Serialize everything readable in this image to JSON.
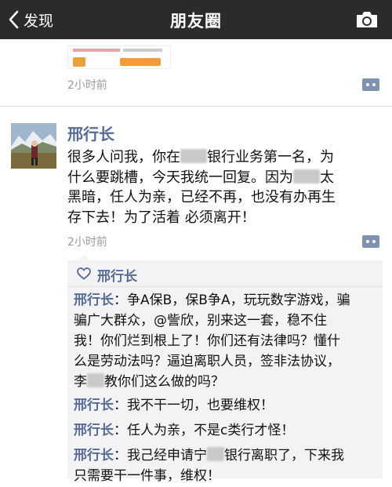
{
  "header": {
    "back_label": "发现",
    "title": "朋友圈"
  },
  "previous_post": {
    "time": "2小时前"
  },
  "post": {
    "author": "邢行长",
    "lines": [
      [
        "很多人问我，你在",
        "银行业务第一名，为"
      ],
      [
        "什么要跳槽，今天我统一回复。因为",
        "太"
      ],
      [
        "黑暗，任人为亲，已经不再，也没有办再生"
      ],
      [
        "存下去！为了活着 必须离开！"
      ]
    ],
    "time": "2小时前"
  },
  "likes": {
    "names": "邢行长"
  },
  "comments": [
    {
      "author": "邢行长",
      "separator": "：",
      "lines": [
        "争A保B，保B争A，玩玩数字游戏，骗",
        "骗广大群众，@訾欣，别来这一套，稳不住",
        "我！你们烂到根上了！你们还有法律吗？懂什",
        "么是劳动法吗？逼迫离职人员，签非法协议，"
      ],
      "last_line_prefix": "李",
      "last_line_suffix": "教你们这么做的吗？"
    },
    {
      "author": "邢行长",
      "separator": "：",
      "text": "我不干一切，也要维权！"
    },
    {
      "author": "邢行长",
      "separator": "：",
      "text": "任人为亲，不是c类行才怪！"
    },
    {
      "author": "邢行长",
      "separator": "：",
      "line1_prefix": "我己经申请宁",
      "line1_suffix": "银行离职了，下来我",
      "line2": "只需要干一件事，维权！"
    }
  ],
  "icons": {
    "back": "chevron-left-icon",
    "camera": "camera-icon",
    "more": "more-dots-icon",
    "like": "heart-icon"
  },
  "colors": {
    "topbar": "#2b2b2d",
    "name_link": "#576b95",
    "time": "#9b9b9b",
    "comment_bg": "#f3f3f5"
  }
}
